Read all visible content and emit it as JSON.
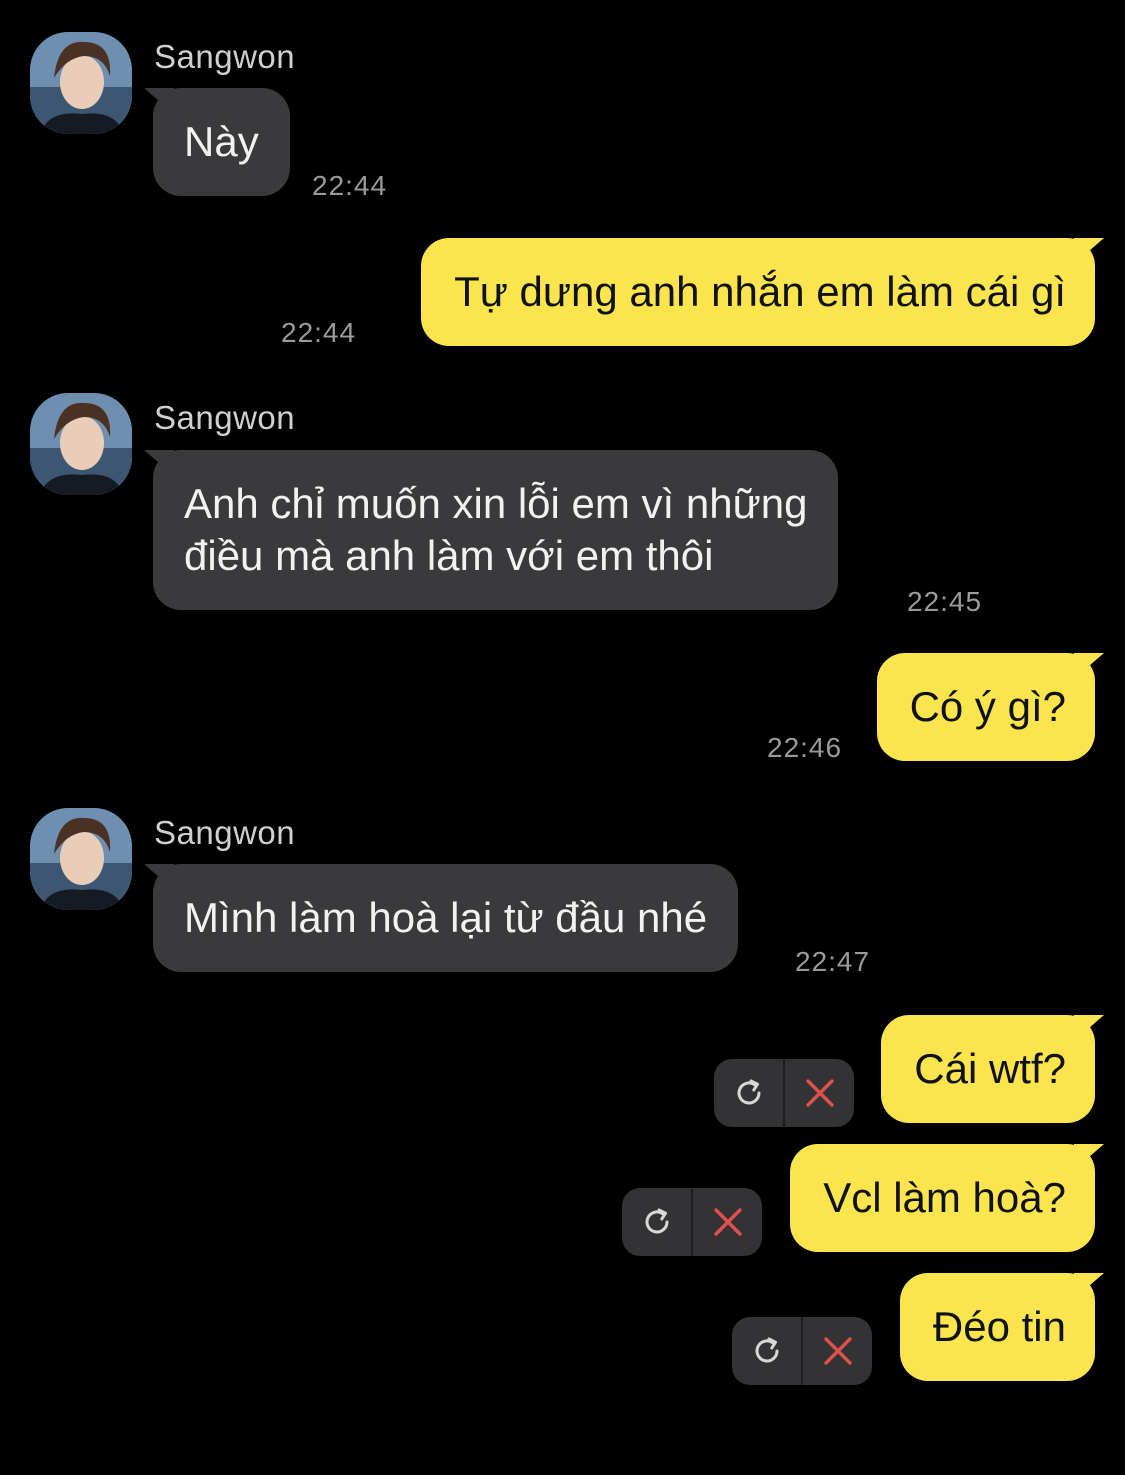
{
  "colors": {
    "background": "#000000",
    "incoming_bubble": "#3a3a3c",
    "outgoing_bubble": "#fae54f",
    "timestamp": "#9a9a9a",
    "delete_icon": "#e0504c"
  },
  "messages": [
    {
      "direction": "in",
      "sender": "Sangwon",
      "lines": [
        "Này"
      ],
      "time": "22:44"
    },
    {
      "direction": "out",
      "lines": [
        "Tự dưng anh nhắn em làm cái gì"
      ],
      "time": "22:44"
    },
    {
      "direction": "in",
      "sender": "Sangwon",
      "lines": [
        "Anh chỉ muốn xin lỗi em vì những",
        "điều mà anh làm với em thôi"
      ],
      "time": "22:45"
    },
    {
      "direction": "out",
      "lines": [
        "Có ý gì?"
      ],
      "time": "22:46"
    },
    {
      "direction": "in",
      "sender": "Sangwon",
      "lines": [
        "Mình làm hoà lại từ đầu nhé"
      ],
      "time": "22:47"
    },
    {
      "direction": "out",
      "lines": [
        "Cái wtf?"
      ],
      "status": "failed",
      "actions": [
        "retry-icon",
        "delete-icon"
      ]
    },
    {
      "direction": "out",
      "lines": [
        "Vcl làm hoà?"
      ],
      "status": "failed",
      "actions": [
        "retry-icon",
        "delete-icon"
      ]
    },
    {
      "direction": "out",
      "lines": [
        "Đéo tin"
      ],
      "status": "failed",
      "actions": [
        "retry-icon",
        "delete-icon"
      ]
    }
  ]
}
